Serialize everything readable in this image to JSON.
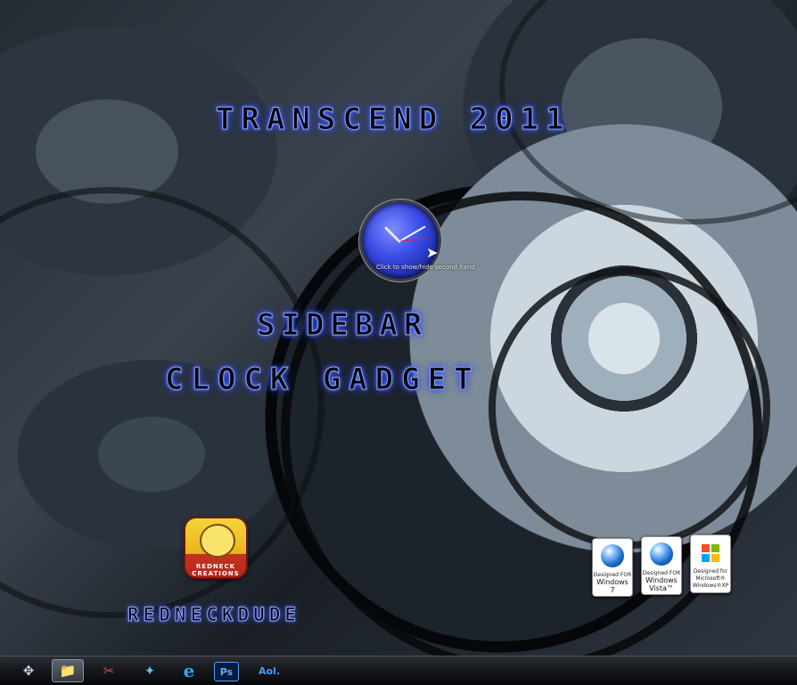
{
  "desktop": {
    "headline": "TRANSCEND 2011",
    "subtitle_1": "SIDEBAR",
    "subtitle_2": "CLOCK GADGET",
    "signature": "REDNECKDUDE"
  },
  "clock_gadget": {
    "caption": "Click to show/hide second hand",
    "cursor_glyph": "➤"
  },
  "logo_badge": {
    "text": "REDNECK CREATIONS"
  },
  "compat_logos": [
    {
      "line1": "Designed FOR",
      "line2": "Windows",
      "line3": "7"
    },
    {
      "line1": "Designed FOR",
      "line2": "Windows",
      "line3": "Vista™"
    },
    {
      "line1": "Designed for",
      "line2": "Microsoft®",
      "line3": "Windows®XP"
    }
  ],
  "taskbar": {
    "icons": [
      {
        "name": "start-orb-icon",
        "glyph": "✥",
        "active": false
      },
      {
        "name": "explorer-icon",
        "glyph": "📁",
        "active": true
      },
      {
        "name": "paint-icon",
        "glyph": "✂",
        "active": false
      },
      {
        "name": "gadget-tool-icon",
        "glyph": "✦",
        "active": false
      },
      {
        "name": "internet-explorer-icon",
        "glyph": "e",
        "active": false
      },
      {
        "name": "photoshop-icon",
        "glyph": "Ps",
        "active": false
      },
      {
        "name": "aol-icon",
        "glyph": "Aol.",
        "active": false
      }
    ]
  }
}
